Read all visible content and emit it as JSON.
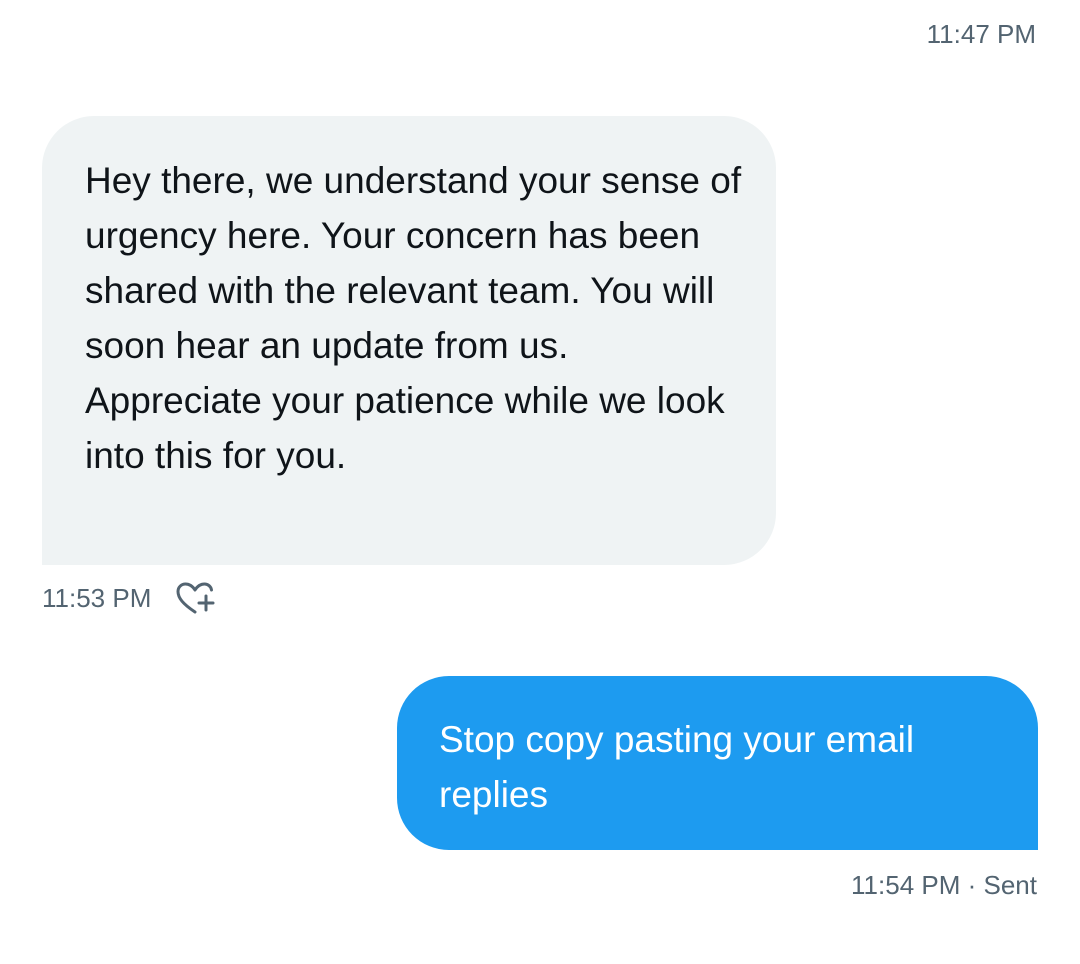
{
  "conversation": {
    "top_timestamp": "11:47 PM",
    "messages": [
      {
        "direction": "received",
        "text": "Hey there, we understand your sense of urgency here. Your concern has been shared with the relevant team. You will soon hear an update from us. Appreciate your patience while we look into this for you.",
        "timestamp": "11:53 PM",
        "reaction_icon": "heart-plus-icon"
      },
      {
        "direction": "sent",
        "text": "Stop copy pasting your email replies",
        "timestamp": "11:54 PM",
        "separator": " · ",
        "status": "Sent"
      }
    ]
  },
  "colors": {
    "received_bubble": "#eff3f4",
    "sent_bubble": "#1d9bf0",
    "secondary_text": "#536471",
    "primary_text": "#0f1419"
  }
}
